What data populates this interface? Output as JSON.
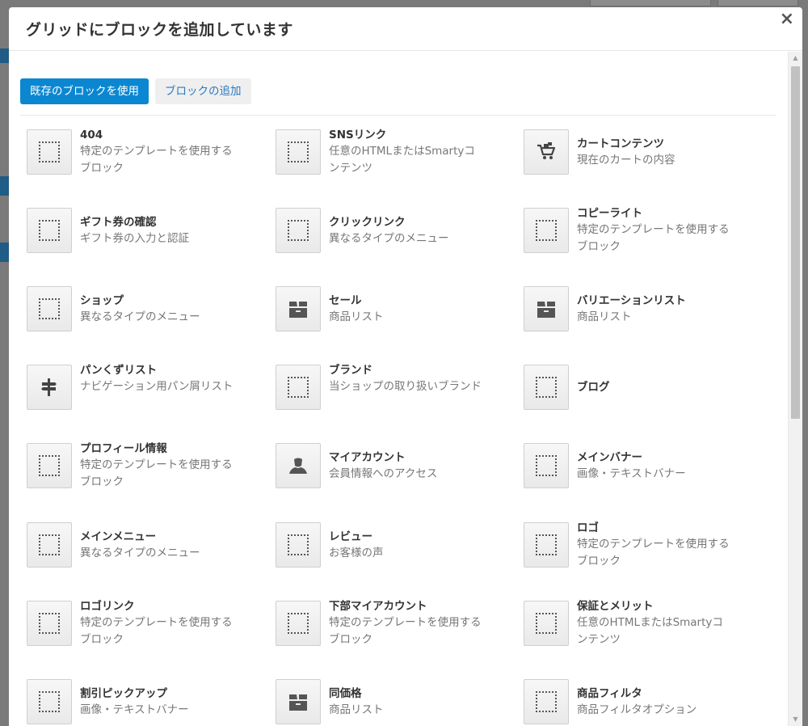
{
  "modal": {
    "title": "グリッドにブロックを追加しています",
    "close": "×"
  },
  "tabs": [
    {
      "label": "既存のブロックを使用",
      "active": true
    },
    {
      "label": "ブロックの追加",
      "active": false
    }
  ],
  "blocks": [
    {
      "name": "404",
      "desc": "特定のテンプレートを使用するブロック",
      "icon": "placeholder-icon"
    },
    {
      "name": "SNSリンク",
      "desc": "任意のHTMLまたはSmartyコンテンツ",
      "icon": "placeholder-icon"
    },
    {
      "name": "カートコンテンツ",
      "desc": "現在のカートの内容",
      "icon": "cart-icon"
    },
    {
      "name": "ギフト券の確認",
      "desc": "ギフト券の入力と認証",
      "icon": "placeholder-icon"
    },
    {
      "name": "クリックリンク",
      "desc": "異なるタイプのメニュー",
      "icon": "placeholder-icon"
    },
    {
      "name": "コピーライト",
      "desc": "特定のテンプレートを使用するブロック",
      "icon": "placeholder-icon"
    },
    {
      "name": "ショップ",
      "desc": "異なるタイプのメニュー",
      "icon": "placeholder-icon"
    },
    {
      "name": "セール",
      "desc": "商品リスト",
      "icon": "box-icon"
    },
    {
      "name": "バリエーションリスト",
      "desc": "商品リスト",
      "icon": "box-icon"
    },
    {
      "name": "パンくずリスト",
      "desc": "ナビゲーション用パン屑リスト",
      "icon": "signpost-icon"
    },
    {
      "name": "ブランド",
      "desc": "当ショップの取り扱いブランド",
      "icon": "placeholder-icon"
    },
    {
      "name": "ブログ",
      "desc": "",
      "icon": "placeholder-icon"
    },
    {
      "name": "プロフィール情報",
      "desc": "特定のテンプレートを使用するブロック",
      "icon": "placeholder-icon"
    },
    {
      "name": "マイアカウント",
      "desc": "会員情報へのアクセス",
      "icon": "user-icon"
    },
    {
      "name": "メインバナー",
      "desc": "画像・テキストバナー",
      "icon": "placeholder-icon"
    },
    {
      "name": "メインメニュー",
      "desc": "異なるタイプのメニュー",
      "icon": "placeholder-icon"
    },
    {
      "name": "レビュー",
      "desc": "お客様の声",
      "icon": "placeholder-icon"
    },
    {
      "name": "ロゴ",
      "desc": "特定のテンプレートを使用するブロック",
      "icon": "placeholder-icon"
    },
    {
      "name": "ロゴリンク",
      "desc": "特定のテンプレートを使用するブロック",
      "icon": "placeholder-icon"
    },
    {
      "name": "下部マイアカウント",
      "desc": "特定のテンプレートを使用するブロック",
      "icon": "placeholder-icon"
    },
    {
      "name": "保証とメリット",
      "desc": "任意のHTMLまたはSmartyコンテンツ",
      "icon": "placeholder-icon"
    },
    {
      "name": "割引ピックアップ",
      "desc": "画像・テキストバナー",
      "icon": "placeholder-icon"
    },
    {
      "name": "同価格",
      "desc": "商品リスト",
      "icon": "box-icon"
    },
    {
      "name": "商品フィルタ",
      "desc": "商品フィルタオプション",
      "icon": "placeholder-icon"
    }
  ]
}
